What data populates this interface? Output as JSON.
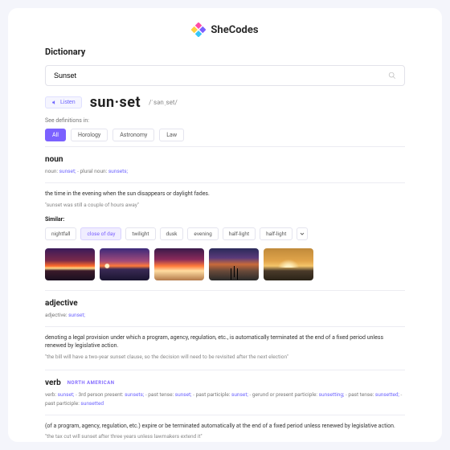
{
  "brand": {
    "name": "SheCodes"
  },
  "app": {
    "title": "Dictionary"
  },
  "search": {
    "value": "Sunset",
    "placeholder": "Sunset"
  },
  "listen": {
    "label": "Listen"
  },
  "entry": {
    "word": "sun·set",
    "phonetic": "/ˈsənˌset/"
  },
  "see": {
    "label": "See definitions in:"
  },
  "tabs": [
    {
      "label": "All",
      "active": true
    },
    {
      "label": "Horology",
      "active": false
    },
    {
      "label": "Astronomy",
      "active": false
    },
    {
      "label": "Law",
      "active": false
    }
  ],
  "noun": {
    "heading": "noun",
    "forms_html": [
      [
        "noun:",
        "sunset;"
      ],
      [
        "plural noun:",
        "sunsets;"
      ]
    ],
    "definition": "the time in the evening when the sun disappears or daylight fades.",
    "example": "\"sunset was still a couple of hours away\"",
    "similar_heading": "Similar:",
    "similar": [
      {
        "label": "nightfall",
        "hi": false
      },
      {
        "label": "close of day",
        "hi": true
      },
      {
        "label": "twilight",
        "hi": false
      },
      {
        "label": "dusk",
        "hi": false
      },
      {
        "label": "evening",
        "hi": false
      },
      {
        "label": "half-light",
        "hi": false
      },
      {
        "label": "half-light",
        "hi": false
      }
    ]
  },
  "adjective": {
    "heading": "adjective",
    "forms_html": [
      [
        "adjective:",
        "sunset;"
      ]
    ],
    "definition": "denoting a legal provision under which a program, agency, regulation, etc., is automatically terminated at the end of a fixed period unless renewed by legislative action.",
    "example": "\"the bill will have a two-year sunset clause, so the decision will need to be revisited after the next election\""
  },
  "verb": {
    "heading": "verb",
    "region": "NORTH AMERICAN",
    "forms_html": [
      [
        "verb:",
        "sunset;"
      ],
      [
        "3rd person present:",
        "sunsets;"
      ],
      [
        "past tense:",
        "sunset;"
      ],
      [
        "past participle:",
        "sunset;"
      ],
      [
        "gerund or present participle:",
        "sunsetting;"
      ],
      [
        "past tense:",
        "sunsetted;"
      ],
      [
        "past participle:",
        "sunsetted"
      ]
    ],
    "definition": "(of a program, agency, regulation, etc.) expire or be terminated automatically at the end of a fixed period unless renewed by legislative action.",
    "example": "\"the tax cut will sunset after three years unless lawmakers extend it\""
  }
}
